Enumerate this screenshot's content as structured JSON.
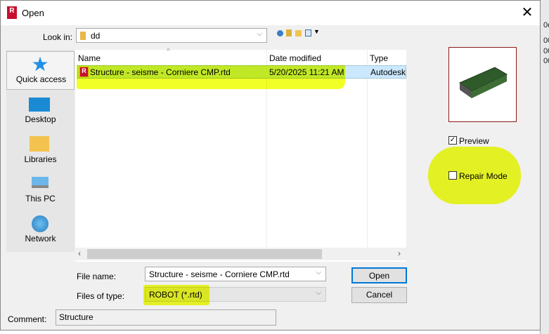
{
  "background": {
    "fragments": [
      "0o",
      "00",
      "00",
      "00"
    ]
  },
  "window": {
    "title": "Open",
    "app_icon": "R",
    "close": "✕"
  },
  "look_in": {
    "label": "Look in:",
    "value": "dd"
  },
  "toolbar": {
    "icons": [
      "back-icon",
      "up-folder-icon",
      "new-folder-icon",
      "view-menu-icon"
    ]
  },
  "places": [
    {
      "label": "Quick access"
    },
    {
      "label": "Desktop"
    },
    {
      "label": "Libraries"
    },
    {
      "label": "This PC"
    },
    {
      "label": "Network"
    }
  ],
  "file_list": {
    "columns": [
      "Name",
      "Date modified",
      "Type"
    ],
    "rows": [
      {
        "name": "Structure - seisme - Corniere CMP.rtd",
        "date": "5/20/2025 11:21 AM",
        "type": "Autodesk"
      }
    ]
  },
  "file_name": {
    "label": "File name:",
    "value": "Structure - seisme - Corniere CMP.rtd"
  },
  "file_type": {
    "label": "Files of type:",
    "value": "ROBOT (*.rtd)"
  },
  "buttons": {
    "open": "Open",
    "cancel": "Cancel"
  },
  "options": {
    "preview": {
      "label": "Preview",
      "checked": true
    },
    "repair": {
      "label": "Repair Mode",
      "checked": false
    }
  },
  "comment": {
    "label": "Comment:",
    "value": "Structure"
  },
  "colors": {
    "highlight": "#f0ff00",
    "selection": "#cce8ff",
    "preview_border": "#8b1a1a"
  }
}
